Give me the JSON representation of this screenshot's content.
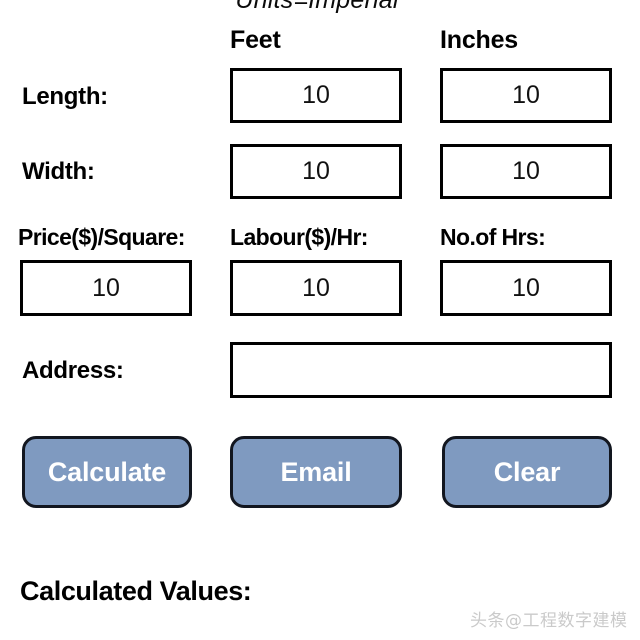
{
  "banner": {
    "units_text": "Units=Imperial"
  },
  "columns": {
    "feet_header": "Feet",
    "inches_header": "Inches"
  },
  "rows": {
    "length": {
      "label": "Length:",
      "feet_value": "10",
      "inches_value": "10"
    },
    "width": {
      "label": "Width:",
      "feet_value": "10",
      "inches_value": "10"
    },
    "price": {
      "label": "Price($)/Square:",
      "value": "10"
    },
    "labour": {
      "label": "Labour($)/Hr:",
      "value": "10"
    },
    "hours": {
      "label": "No.of Hrs:",
      "value": "10"
    },
    "address": {
      "label": "Address:",
      "value": "",
      "placeholder": ""
    }
  },
  "buttons": {
    "calculate": "Calculate",
    "email": "Email",
    "clear": "Clear",
    "fill_color": "#7f9ac0",
    "border_color": "#12161f",
    "text_color": "#ffffff"
  },
  "results": {
    "heading": "Calculated Values:"
  },
  "watermark": {
    "text": "头条@工程数字建模"
  }
}
